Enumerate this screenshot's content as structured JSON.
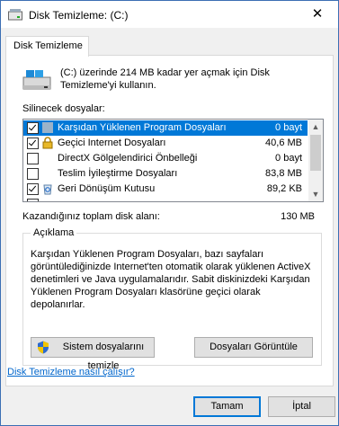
{
  "window": {
    "title": "Disk Temizleme: (C:)",
    "close_glyph": "✕"
  },
  "tab": {
    "label": "Disk Temizleme"
  },
  "intro_text": "(C:) üzerinde 214 MB kadar yer açmak için Disk Temizleme'yi kullanın.",
  "list": {
    "label": "Silinecek dosyalar:",
    "items": [
      {
        "label": "Karşıdan Yüklenen Program Dosyaları",
        "size": "0 bayt",
        "checked": true,
        "selected": true,
        "icon": "folder-icon"
      },
      {
        "label": "Geçici Internet Dosyaları",
        "size": "40,6 MB",
        "checked": true,
        "selected": false,
        "icon": "lock-icon"
      },
      {
        "label": "DirectX Gölgelendirici Önbelleği",
        "size": "0 bayt",
        "checked": false,
        "selected": false,
        "icon": "none"
      },
      {
        "label": "Teslim İyileştirme Dosyaları",
        "size": "83,8 MB",
        "checked": false,
        "selected": false,
        "icon": "none"
      },
      {
        "label": "Geri Dönüşüm Kutusu",
        "size": "89,2 KB",
        "checked": true,
        "selected": false,
        "icon": "recycle-bin-icon"
      },
      {
        "label": "",
        "size": "",
        "checked": false,
        "selected": false,
        "icon": "none"
      }
    ]
  },
  "total": {
    "label": "Kazandığınız toplam disk alanı:",
    "value": "130 MB"
  },
  "description": {
    "title": "Açıklama",
    "text": "Karşıdan Yüklenen Program Dosyaları, bazı sayfaları görüntülediğinizde Internet'ten otomatik olarak yüklenen ActiveX denetimleri ve Java uygulamalarıdır. Sabit diskinizdeki Karşıdan Yüklenen Program Dosyaları klasörüne geçici olarak depolanırlar."
  },
  "buttons": {
    "cleanup_system": "Sistem dosyalarını temizle",
    "view_files": "Dosyaları Görüntüle",
    "ok": "Tamam",
    "cancel": "İptal"
  },
  "help_link": "Disk Temizleme nasıl çalışır?",
  "colors": {
    "selection": "#0078d7",
    "link": "#0066cc"
  }
}
